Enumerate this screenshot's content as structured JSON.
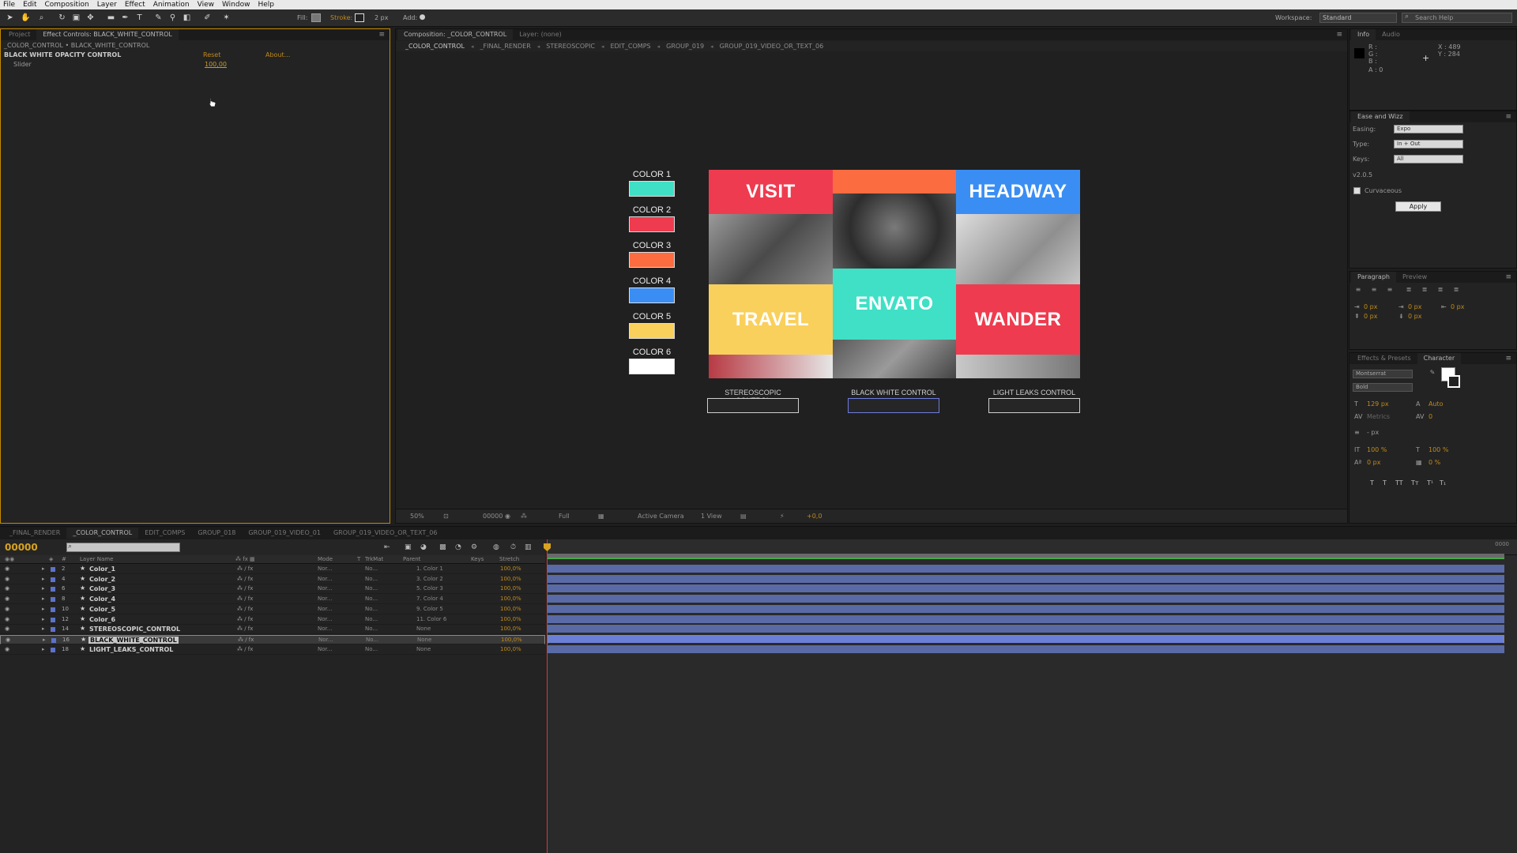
{
  "menu": [
    "File",
    "Edit",
    "Composition",
    "Layer",
    "Effect",
    "Animation",
    "View",
    "Window",
    "Help"
  ],
  "toolbar": {
    "fill_label": "Fill:",
    "stroke_label": "Stroke:",
    "stroke_px": "2 px",
    "add_label": "Add:",
    "workspace_label": "Workspace:",
    "workspace_value": "Standard",
    "search_placeholder": "Search Help"
  },
  "effect_panel": {
    "tabs": [
      "Project",
      "Effect Controls: BLACK_WHITE_CONTROL"
    ],
    "path": "_COLOR_CONTROL • BLACK_WHITE_CONTROL",
    "effect_name": "BLACK WHITE OPACITY CONTROL",
    "reset": "Reset",
    "about": "About...",
    "slider_label": "Slider",
    "slider_value": "100,00"
  },
  "comp_panel": {
    "tabs": [
      "Composition: _COLOR_CONTROL",
      "Layer: (none)"
    ],
    "breadcrumbs": [
      "_COLOR_CONTROL",
      "_FINAL_RENDER",
      "STEREOSCOPIC",
      "EDIT_COMPS",
      "GROUP_019",
      "GROUP_019_VIDEO_OR_TEXT_06"
    ],
    "footer": {
      "zoom": "50%",
      "timecode": "00000",
      "resolution": "Full",
      "camera": "Active Camera",
      "views": "1 View",
      "exposure": "+0,0"
    }
  },
  "canvas": {
    "colors": [
      {
        "label": "COLOR 1",
        "hex": "#40e0c6"
      },
      {
        "label": "COLOR 2",
        "hex": "#ef3b4f"
      },
      {
        "label": "COLOR 3",
        "hex": "#fb6c40"
      },
      {
        "label": "COLOR 4",
        "hex": "#3a8ef3"
      },
      {
        "label": "COLOR 5",
        "hex": "#fad05c"
      },
      {
        "label": "COLOR 6",
        "hex": "#ffffff"
      }
    ],
    "tiles": {
      "visit": "VISIT",
      "headway": "HEADWAY",
      "travel": "TRAVEL",
      "envato": "ENVATO",
      "wander": "WANDER"
    },
    "controls": [
      "STEREOSCOPIC CONTROL",
      "BLACK WHITE CONTROL",
      "LIGHT LEAKS CONTROL"
    ]
  },
  "info_panel": {
    "tabs": [
      "Info",
      "Audio"
    ],
    "r": "R :",
    "g": "G :",
    "b": "B :",
    "a": "A : 0",
    "x": "X : 489",
    "y": "Y : 284"
  },
  "ease_panel": {
    "title": "Ease and Wizz",
    "easing_label": "Easing:",
    "easing_value": "Expo",
    "type_label": "Type:",
    "type_value": "In + Out",
    "keys_label": "Keys:",
    "keys_value": "All",
    "version": "v2.0.5",
    "curvaceous": "Curvaceous",
    "apply": "Apply"
  },
  "para_panel": {
    "tabs": [
      "Paragraph",
      "Preview"
    ],
    "indent_left": "0 px",
    "indent_first": "0 px",
    "indent_right": "0 px",
    "space_before": "0 px",
    "space_after": "0 px"
  },
  "char_panel": {
    "tabs": [
      "Effects & Presets",
      "Character"
    ],
    "font": "Montserrat",
    "style": "Bold",
    "size": "129 px",
    "leading": "Auto",
    "kerning": "Metrics",
    "tracking": "0",
    "stroke_px": "- px",
    "vscale": "100 %",
    "hscale": "100 %",
    "baseline": "0 px",
    "tsume": "0 %"
  },
  "timeline": {
    "tabs": [
      "_FINAL_RENDER",
      "_COLOR_CONTROL",
      "EDIT_COMPS",
      "GROUP_018",
      "GROUP_019_VIDEO_01",
      "GROUP_019_VIDEO_OR_TEXT_06"
    ],
    "timecode": "00000",
    "col_layer": "Layer Name",
    "col_mode": "Mode",
    "col_t": "T",
    "col_trkmat": "TrkMat",
    "col_parent": "Parent",
    "col_keys": "Keys",
    "col_stretch": "Stretch",
    "ruler_end": "0000",
    "layers": [
      {
        "num": "2",
        "name": "Color_1",
        "mode": "Nor...",
        "trk": "No...",
        "parent": "1. Color 1",
        "stretch": "100,0%"
      },
      {
        "num": "4",
        "name": "Color_2",
        "mode": "Nor...",
        "trk": "No...",
        "parent": "3. Color 2",
        "stretch": "100,0%"
      },
      {
        "num": "6",
        "name": "Color_3",
        "mode": "Nor...",
        "trk": "No...",
        "parent": "5. Color 3",
        "stretch": "100,0%"
      },
      {
        "num": "8",
        "name": "Color_4",
        "mode": "Nor...",
        "trk": "No...",
        "parent": "7. Color 4",
        "stretch": "100,0%"
      },
      {
        "num": "10",
        "name": "Color_5",
        "mode": "Nor...",
        "trk": "No...",
        "parent": "9. Color 5",
        "stretch": "100,0%"
      },
      {
        "num": "12",
        "name": "Color_6",
        "mode": "Nor...",
        "trk": "No...",
        "parent": "11. Color 6",
        "stretch": "100,0%"
      },
      {
        "num": "14",
        "name": "STEREOSCOPIC_CONTROL",
        "mode": "Nor...",
        "trk": "No...",
        "parent": "None",
        "stretch": "100,0%"
      },
      {
        "num": "16",
        "name": "BLACK_WHITE_CONTROL",
        "mode": "Nor...",
        "trk": "No...",
        "parent": "None",
        "stretch": "100,0%",
        "selected": true
      },
      {
        "num": "18",
        "name": "LIGHT_LEAKS_CONTROL",
        "mode": "Nor...",
        "trk": "No...",
        "parent": "None",
        "stretch": "100,0%"
      }
    ]
  }
}
